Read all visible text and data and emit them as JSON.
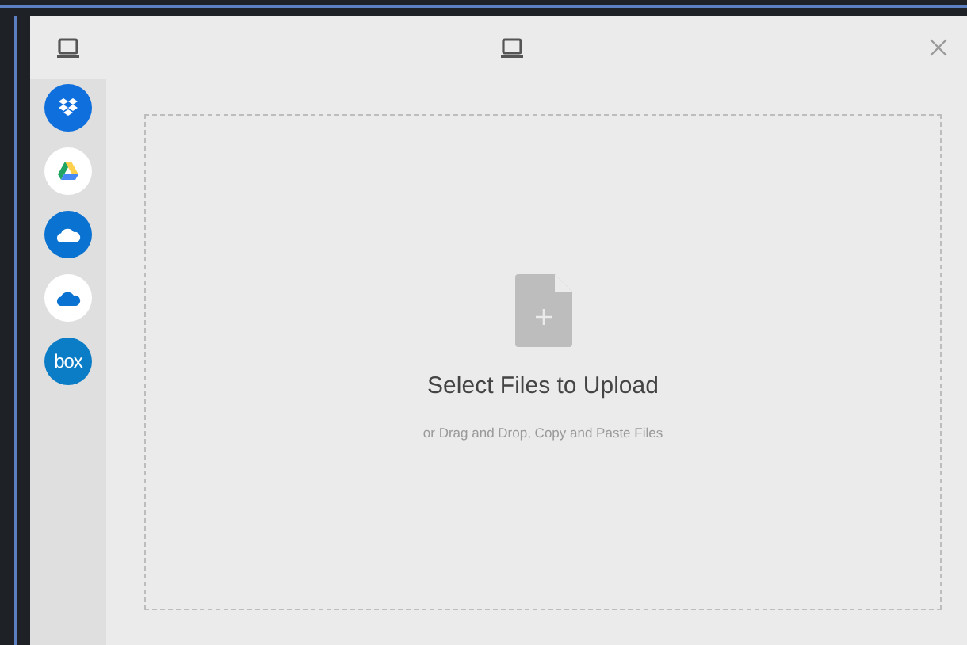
{
  "sources": [
    {
      "kind": "dropbox",
      "color": "#0f6fdc"
    },
    {
      "kind": "drive",
      "color": "#ffffff"
    },
    {
      "kind": "onedrive",
      "color": "#0a72d1"
    },
    {
      "kind": "onedrive_business",
      "color": "#ffffff"
    },
    {
      "kind": "box",
      "color": "#0b7dc6",
      "label": "box"
    }
  ],
  "dropzone": {
    "title": "Select Files to Upload",
    "subtitle": "or Drag and Drop, Copy and Paste Files"
  }
}
